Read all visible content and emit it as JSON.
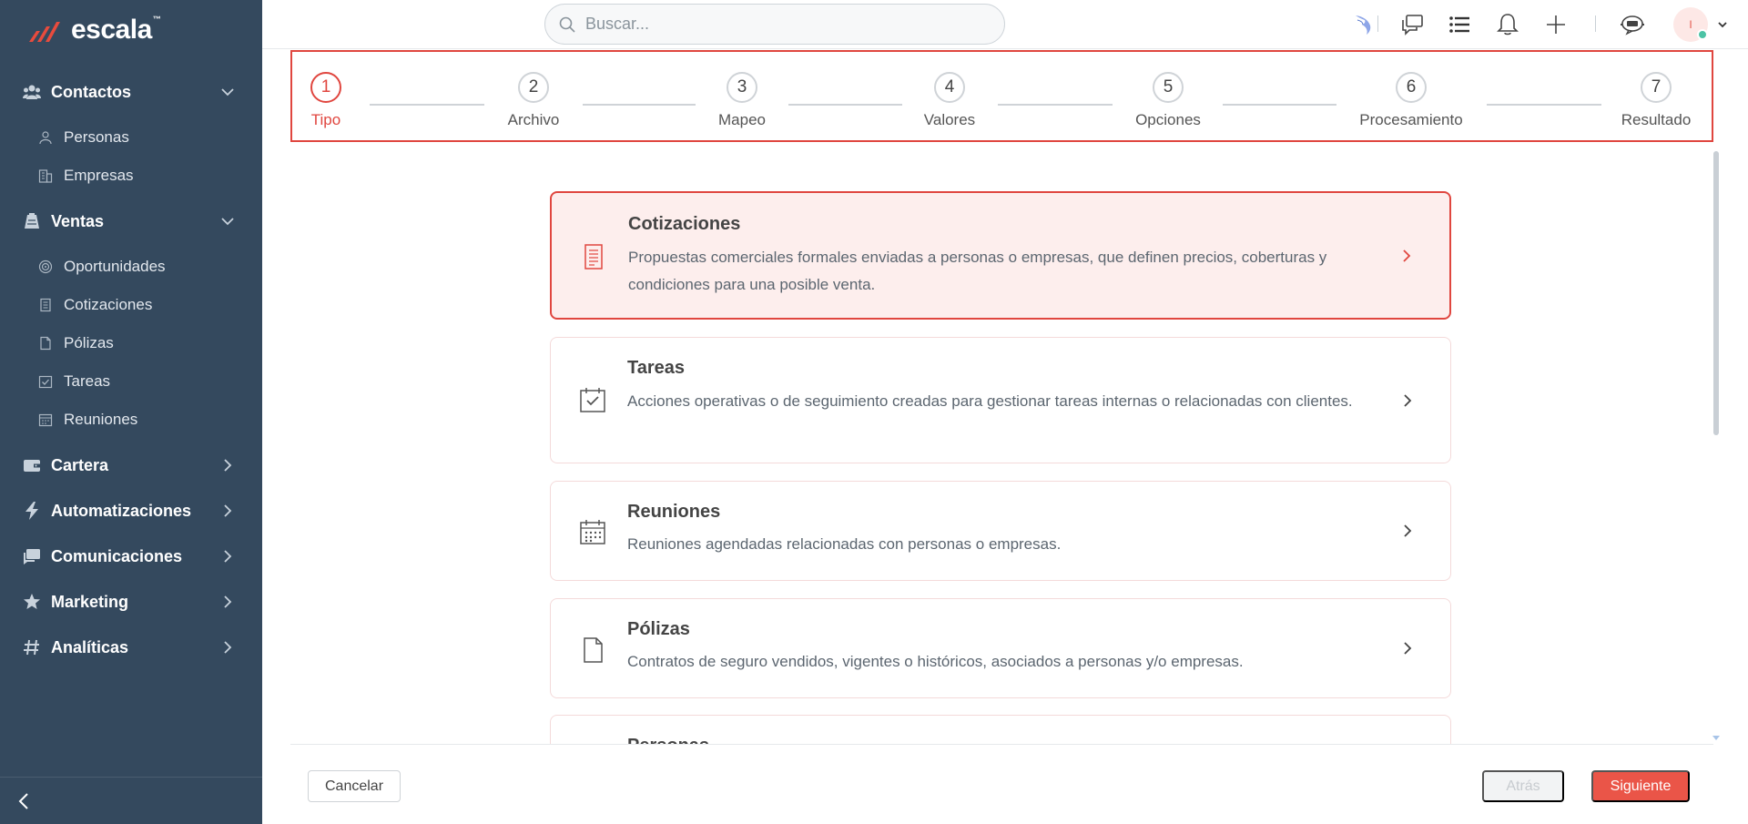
{
  "app": {
    "logo_text": "escala",
    "logo_tm": "™"
  },
  "sidebar": {
    "sections": [
      {
        "label": "Contactos",
        "icon": "contacts-icon",
        "expanded": true,
        "items": [
          {
            "label": "Personas",
            "icon": "person-icon"
          },
          {
            "label": "Empresas",
            "icon": "building-icon"
          }
        ]
      },
      {
        "label": "Ventas",
        "icon": "sales-icon",
        "expanded": true,
        "items": [
          {
            "label": "Oportunidades",
            "icon": "target-icon"
          },
          {
            "label": "Cotizaciones",
            "icon": "quote-icon"
          },
          {
            "label": "Pólizas",
            "icon": "document-icon"
          },
          {
            "label": "Tareas",
            "icon": "task-icon"
          },
          {
            "label": "Reuniones",
            "icon": "calendar-icon"
          }
        ]
      },
      {
        "label": "Cartera",
        "icon": "wallet-icon",
        "expanded": false
      },
      {
        "label": "Automatizaciones",
        "icon": "bolt-icon",
        "expanded": false
      },
      {
        "label": "Comunicaciones",
        "icon": "chat-icon",
        "expanded": false
      },
      {
        "label": "Marketing",
        "icon": "star-icon",
        "expanded": false
      },
      {
        "label": "Analíticas",
        "icon": "hash-icon",
        "expanded": false
      }
    ]
  },
  "topbar": {
    "search_placeholder": "Buscar...",
    "avatar_initial": "I",
    "icons": [
      "bird-icon",
      "chat-bubbles-icon",
      "list-icon",
      "bell-icon",
      "plus-icon",
      "support-chat-icon",
      "chevron-down-icon"
    ]
  },
  "stepper": {
    "active_step": 1,
    "steps": [
      {
        "num": "1",
        "label": "Tipo"
      },
      {
        "num": "2",
        "label": "Archivo"
      },
      {
        "num": "3",
        "label": "Mapeo"
      },
      {
        "num": "4",
        "label": "Valores"
      },
      {
        "num": "5",
        "label": "Opciones"
      },
      {
        "num": "6",
        "label": "Procesamiento"
      },
      {
        "num": "7",
        "label": "Resultado"
      }
    ]
  },
  "cards": [
    {
      "title": "Cotizaciones",
      "desc": "Propuestas comerciales formales enviadas a personas o empresas, que definen precios, coberturas y condiciones para una posible venta.",
      "icon": "quote-icon",
      "selected": true
    },
    {
      "title": "Tareas",
      "desc": "Acciones operativas o de seguimiento creadas para gestionar tareas internas o relacionadas con clientes.",
      "icon": "task-icon",
      "selected": false
    },
    {
      "title": "Reuniones",
      "desc": "Reuniones agendadas relacionadas con personas o empresas.",
      "icon": "calendar-icon",
      "selected": false
    },
    {
      "title": "Pólizas",
      "desc": "Contratos de seguro vendidos, vigentes o históricos, asociados a personas y/o empresas.",
      "icon": "document-icon",
      "selected": false
    },
    {
      "title": "Personas",
      "desc": "",
      "icon": "person-icon",
      "selected": false
    }
  ],
  "footer": {
    "cancel": "Cancelar",
    "back": "Atrás",
    "next": "Siguiente"
  },
  "colors": {
    "accent": "#e0463f",
    "sidebar_bg": "#34495e",
    "next_button": "#ea5548",
    "selected_card_bg": "#fdeeed"
  }
}
